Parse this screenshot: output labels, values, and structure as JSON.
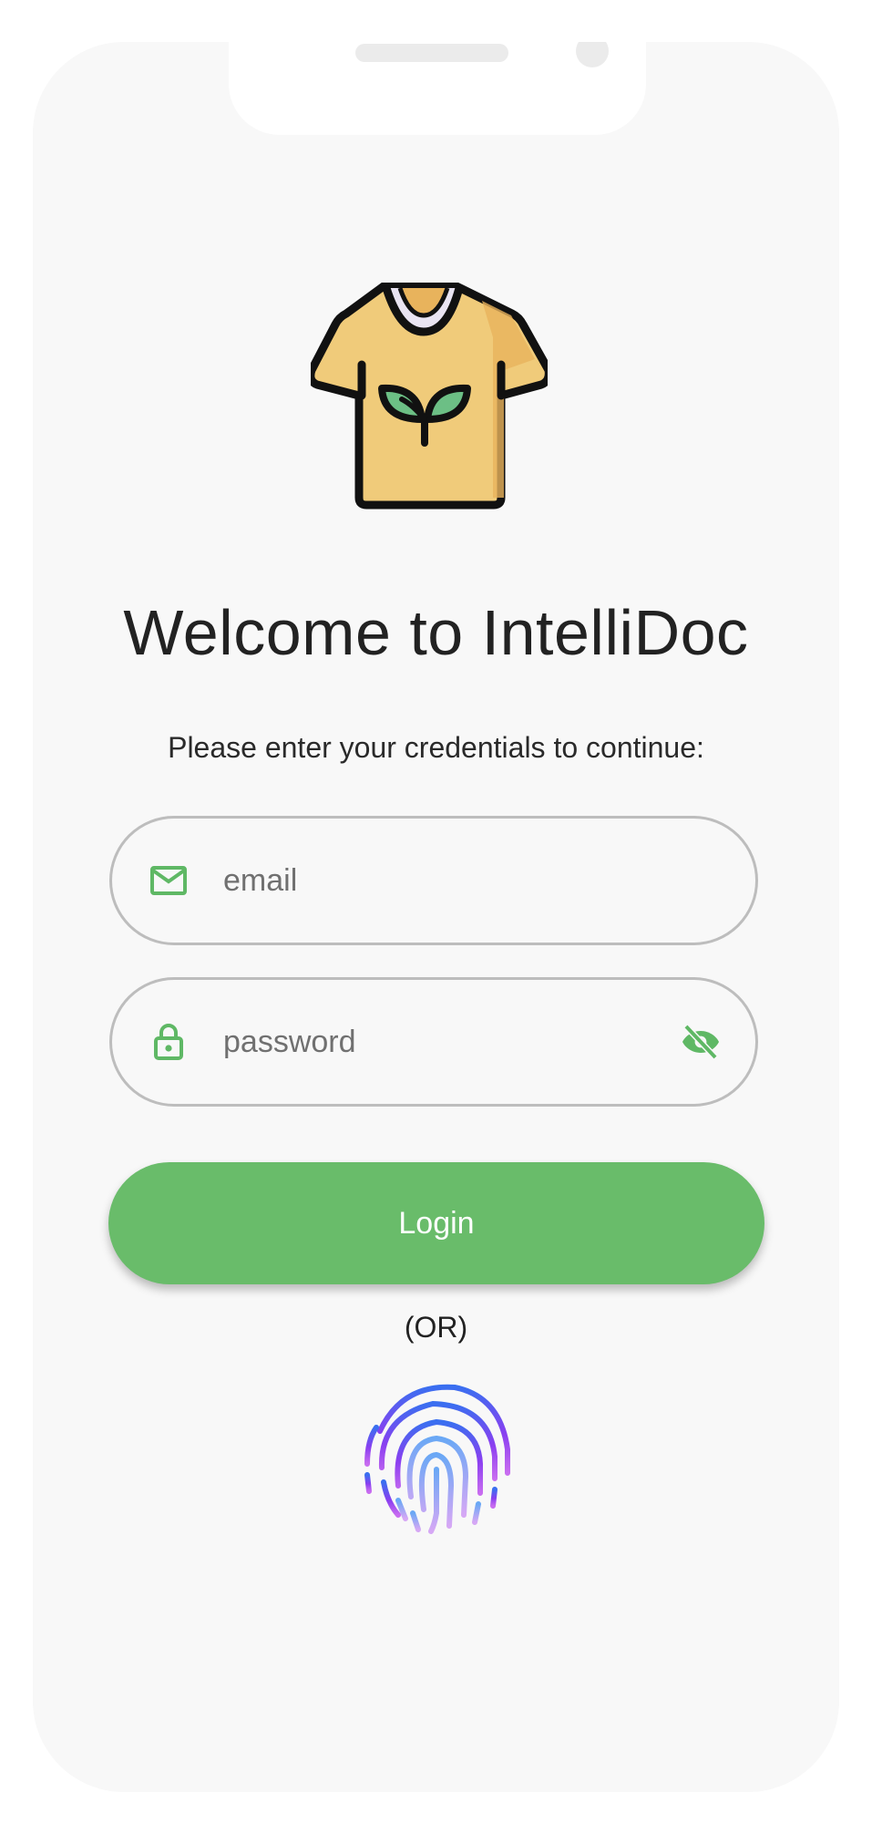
{
  "app": {
    "title": "Welcome to IntelliDoc",
    "subtitle": "Please enter your credentials to continue:"
  },
  "logo": {
    "icon": "eco-tshirt-icon"
  },
  "form": {
    "email": {
      "placeholder": "email",
      "value": "",
      "icon": "mail-icon"
    },
    "password": {
      "placeholder": "password",
      "value": "",
      "icon": "lock-icon",
      "toggle_icon": "eye-off-icon"
    },
    "login_label": "Login",
    "or_label": "(OR)",
    "biometric_icon": "fingerprint-icon"
  },
  "colors": {
    "accent": "#69bc6a",
    "background": "#f8f8f8",
    "field_border": "#bdbdbd"
  }
}
